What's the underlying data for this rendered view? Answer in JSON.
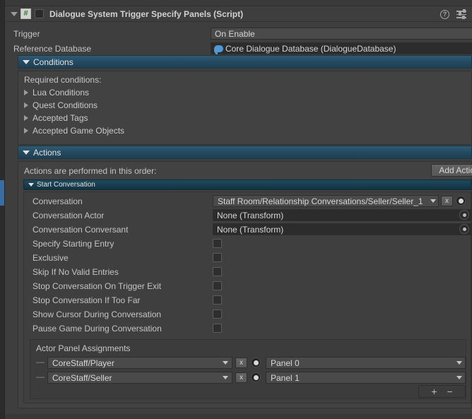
{
  "window": {
    "background_color": "#383838",
    "accent_color": "#3a6da3",
    "section_header_color": "#2f5a74"
  },
  "component": {
    "title": "Dialogue System Trigger Specify Panels (Script)",
    "script_icon_glyph": "#",
    "enabled": false,
    "foldout_expanded": true,
    "help_icon": "help-icon",
    "preset_icon": "preset-icon"
  },
  "properties": {
    "trigger": {
      "label": "Trigger",
      "value": "On Enable"
    },
    "reference_database": {
      "label": "Reference Database",
      "value": "Core Dialogue Database (DialogueDatabase)"
    }
  },
  "conditions": {
    "header": "Conditions",
    "expanded": true,
    "required_label": "Required conditions:",
    "items": [
      {
        "label": "Lua Conditions",
        "expanded": false
      },
      {
        "label": "Quest Conditions",
        "expanded": false
      },
      {
        "label": "Accepted Tags",
        "expanded": false
      },
      {
        "label": "Accepted Game Objects",
        "expanded": false
      }
    ]
  },
  "actions": {
    "header": "Actions",
    "expanded": true,
    "order_label": "Actions are performed in this order:",
    "add_action_label": "Add Action",
    "start_conversation": {
      "header": "Start Conversation",
      "expanded": true,
      "fields": [
        {
          "label": "Conversation",
          "value": "Staff Room/Relationship Conversations/Seller/Seller_1",
          "type": "dropdown-with-clear"
        },
        {
          "label": "Conversation Actor",
          "value": "None (Transform)",
          "type": "object"
        },
        {
          "label": "Conversation Conversant",
          "value": "None (Transform)",
          "type": "object"
        }
      ],
      "toggles": [
        {
          "label": "Specify Starting Entry",
          "checked": false
        },
        {
          "label": "Exclusive",
          "checked": false
        },
        {
          "label": "Skip If No Valid Entries",
          "checked": false
        },
        {
          "label": "Stop Conversation On Trigger Exit",
          "checked": false
        },
        {
          "label": "Stop Conversation If Too Far",
          "checked": false
        },
        {
          "label": "Show Cursor During Conversation",
          "checked": false
        },
        {
          "label": "Pause Game During Conversation",
          "checked": false
        }
      ],
      "actor_panel_assignments": {
        "header": "Actor Panel Assignments",
        "rows": [
          {
            "actor": "CoreStaff/Player",
            "clear_label": "x",
            "panel": "Panel 0"
          },
          {
            "actor": "CoreStaff/Seller",
            "clear_label": "x",
            "panel": "Panel 1"
          }
        ],
        "add_label": "+",
        "remove_label": "−"
      }
    }
  }
}
